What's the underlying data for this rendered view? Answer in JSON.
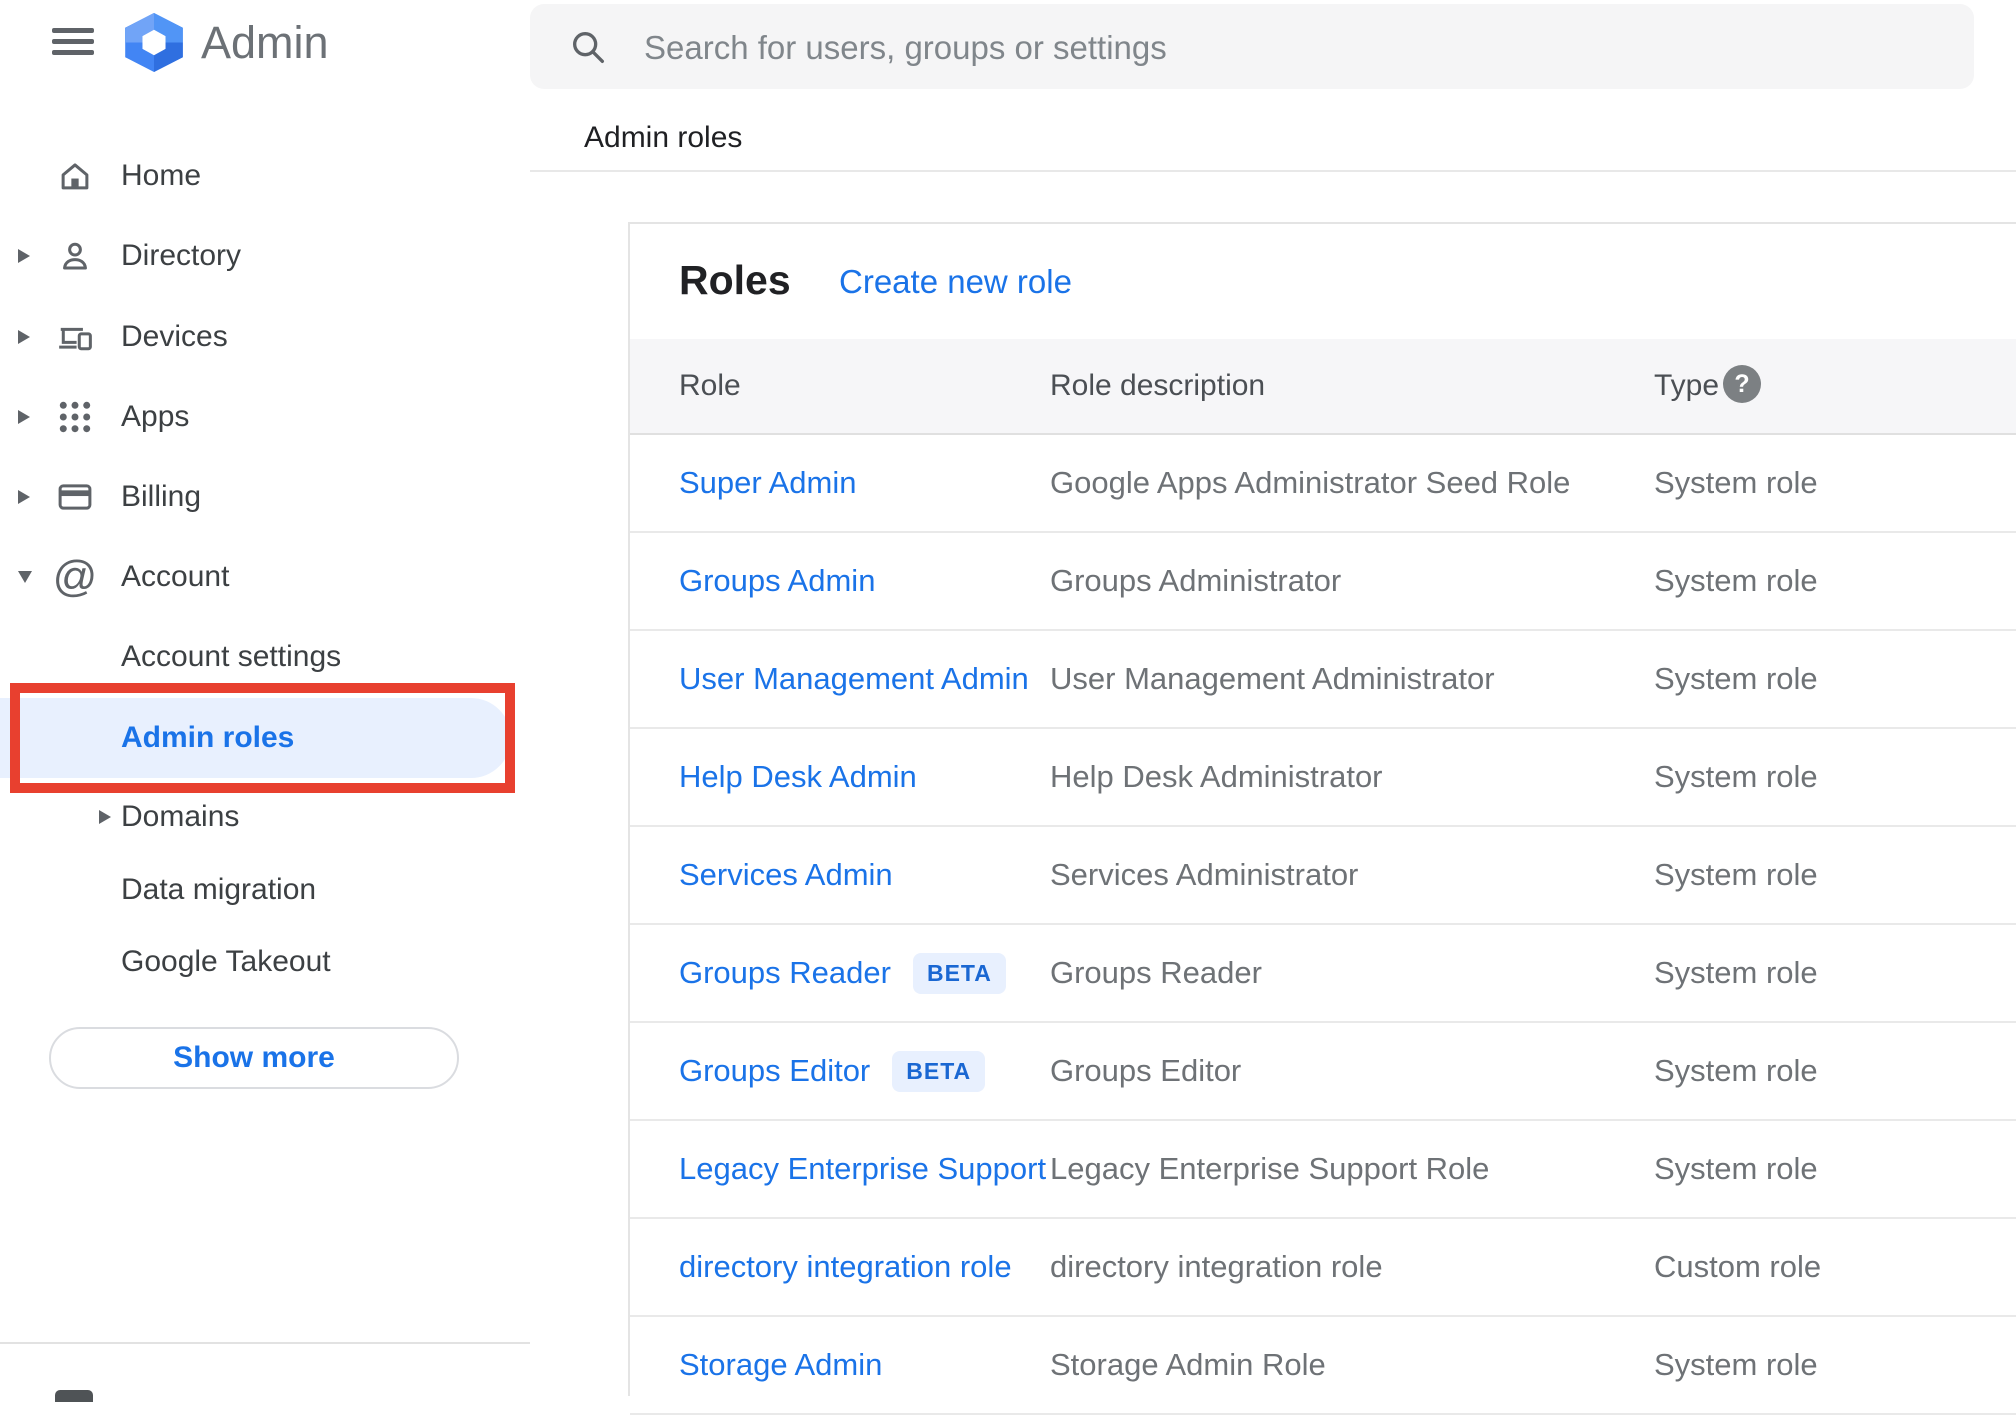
{
  "sidebar": {
    "logo_text": "Admin",
    "menu_icon": "hamburger-icon",
    "items": [
      {
        "label": "Home",
        "icon": "home-icon",
        "expand": null,
        "sub": false,
        "selected": false
      },
      {
        "label": "Directory",
        "icon": "person-icon",
        "expand": "right",
        "sub": false,
        "selected": false
      },
      {
        "label": "Devices",
        "icon": "devices-icon",
        "expand": "right",
        "sub": false,
        "selected": false
      },
      {
        "label": "Apps",
        "icon": "apps-icon",
        "expand": "right",
        "sub": false,
        "selected": false
      },
      {
        "label": "Billing",
        "icon": "billing-icon",
        "expand": "right",
        "sub": false,
        "selected": false
      },
      {
        "label": "Account",
        "icon": "at-icon",
        "expand": "down",
        "sub": false,
        "selected": false
      },
      {
        "label": "Account settings",
        "icon": null,
        "expand": null,
        "sub": true,
        "selected": false
      },
      {
        "label": "Admin roles",
        "icon": null,
        "expand": null,
        "sub": true,
        "selected": true
      },
      {
        "label": "Domains",
        "icon": null,
        "expand": "right",
        "sub": true,
        "selected": false
      },
      {
        "label": "Data migration",
        "icon": null,
        "expand": null,
        "sub": true,
        "selected": false
      },
      {
        "label": "Google Takeout",
        "icon": null,
        "expand": null,
        "sub": true,
        "selected": false
      }
    ],
    "show_more_label": "Show more",
    "annotation": {
      "color": "#e8402f",
      "target": "Admin roles"
    }
  },
  "search": {
    "placeholder": "Search for users, groups or settings",
    "icon": "search-icon"
  },
  "breadcrumb": "Admin roles",
  "card": {
    "title": "Roles",
    "create_link": "Create new role",
    "columns": [
      "Role",
      "Role description",
      "Type"
    ],
    "help_glyph": "?",
    "beta_label": "BETA",
    "rows": [
      {
        "role": "Super Admin",
        "beta": false,
        "description": "Google Apps Administrator Seed Role",
        "type": "System role"
      },
      {
        "role": "Groups Admin",
        "beta": false,
        "description": "Groups Administrator",
        "type": "System role"
      },
      {
        "role": "User Management Admin",
        "beta": false,
        "description": "User Management Administrator",
        "type": "System role"
      },
      {
        "role": "Help Desk Admin",
        "beta": false,
        "description": "Help Desk Administrator",
        "type": "System role"
      },
      {
        "role": "Services Admin",
        "beta": false,
        "description": "Services Administrator",
        "type": "System role"
      },
      {
        "role": "Groups Reader",
        "beta": true,
        "description": "Groups Reader",
        "type": "System role"
      },
      {
        "role": "Groups Editor",
        "beta": true,
        "description": "Groups Editor",
        "type": "System role"
      },
      {
        "role": "Legacy Enterprise Support",
        "beta": false,
        "description": "Legacy Enterprise Support Role",
        "type": "System role"
      },
      {
        "role": "directory integration role",
        "beta": false,
        "description": "directory integration role",
        "type": "Custom role"
      },
      {
        "role": "Storage Admin",
        "beta": false,
        "description": "Storage Admin Role",
        "type": "System role"
      }
    ]
  },
  "colors": {
    "accent_blue": "#1a73e8",
    "selected_pill_bg": "#e8f0fe",
    "annotation_red": "#e8402f",
    "beta_bg": "#e8f0fe",
    "beta_text": "#1a67d2",
    "text_dark": "#202124",
    "text_gray": "#6e7276",
    "icon_gray": "#5f6368"
  }
}
